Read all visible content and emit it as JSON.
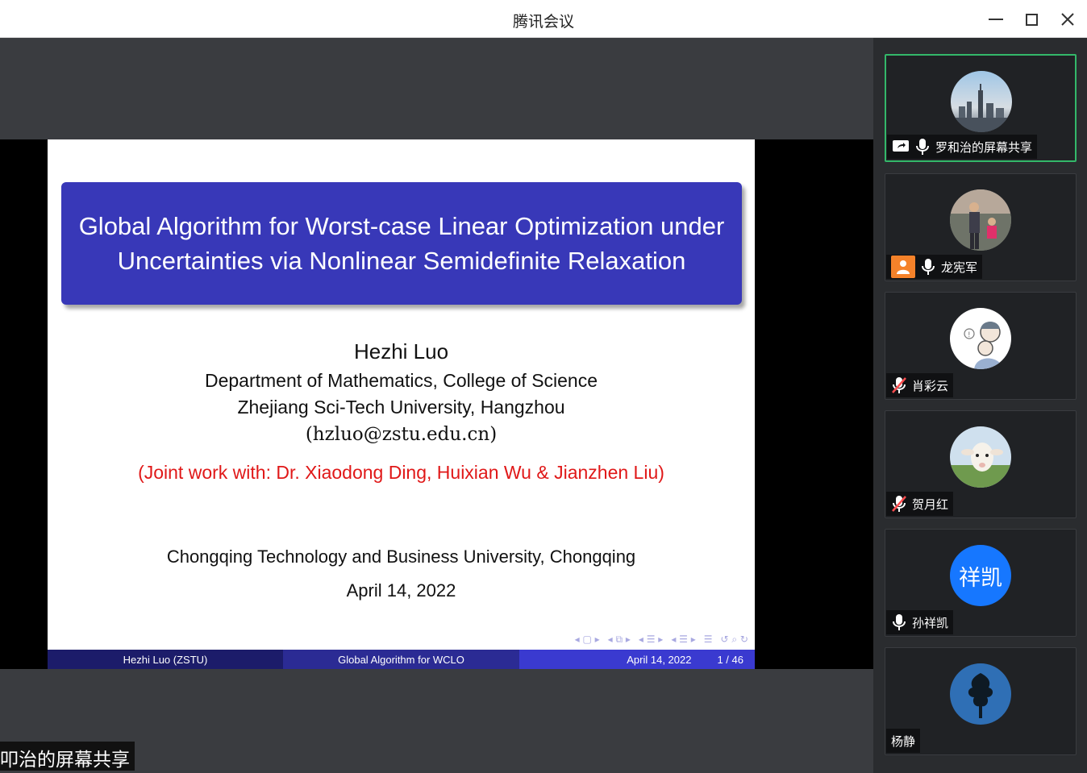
{
  "window": {
    "title": "腾讯会议"
  },
  "slide": {
    "title": "Global Algorithm for Worst-case Linear Optimization under Uncertainties via Nonlinear Semidefinite Relaxation",
    "author": "Hezhi Luo",
    "department": "Department of Mathematics, College of Science",
    "university": "Zhejiang Sci-Tech University, Hangzhou",
    "email": "(hzluo@zstu.edu.cn)",
    "joint": "(Joint work with: Dr. Xiaodong Ding, Huixian Wu & Jianzhen Liu)",
    "venue": "Chongqing Technology and Business University, Chongqing",
    "date": "April 14, 2022",
    "footer": {
      "left": "Hezhi Luo  (ZSTU)",
      "center": "Global Algorithm for WCLO",
      "date": "April 14, 2022",
      "page": "1 / 46"
    }
  },
  "share_caption": "叩治的屏幕共享",
  "participants": [
    {
      "name": "罗和治的屏幕共享",
      "status": "sharing",
      "mic": "on",
      "avatar_icon": "city-skyline-photo"
    },
    {
      "name": "龙宪军",
      "status": "host",
      "mic": "on",
      "avatar_icon": "family-photo"
    },
    {
      "name": "肖彩云",
      "status": "none",
      "mic": "muted",
      "avatar_icon": "cartoon-avatar"
    },
    {
      "name": "贺月红",
      "status": "none",
      "mic": "muted",
      "avatar_icon": "lamb-photo"
    },
    {
      "name": "孙祥凯",
      "status": "none",
      "mic": "on",
      "avatar_text": "祥凯"
    },
    {
      "name": "杨静",
      "status": "none",
      "mic": "none",
      "avatar_icon": "tree-logo"
    }
  ],
  "colors": {
    "slide_title_bg": "#3838b8",
    "joint_text": "#e01818",
    "active_border": "#33b86a",
    "text_avatar_bg": "#1677ff",
    "host_badge": "#f5822a"
  }
}
